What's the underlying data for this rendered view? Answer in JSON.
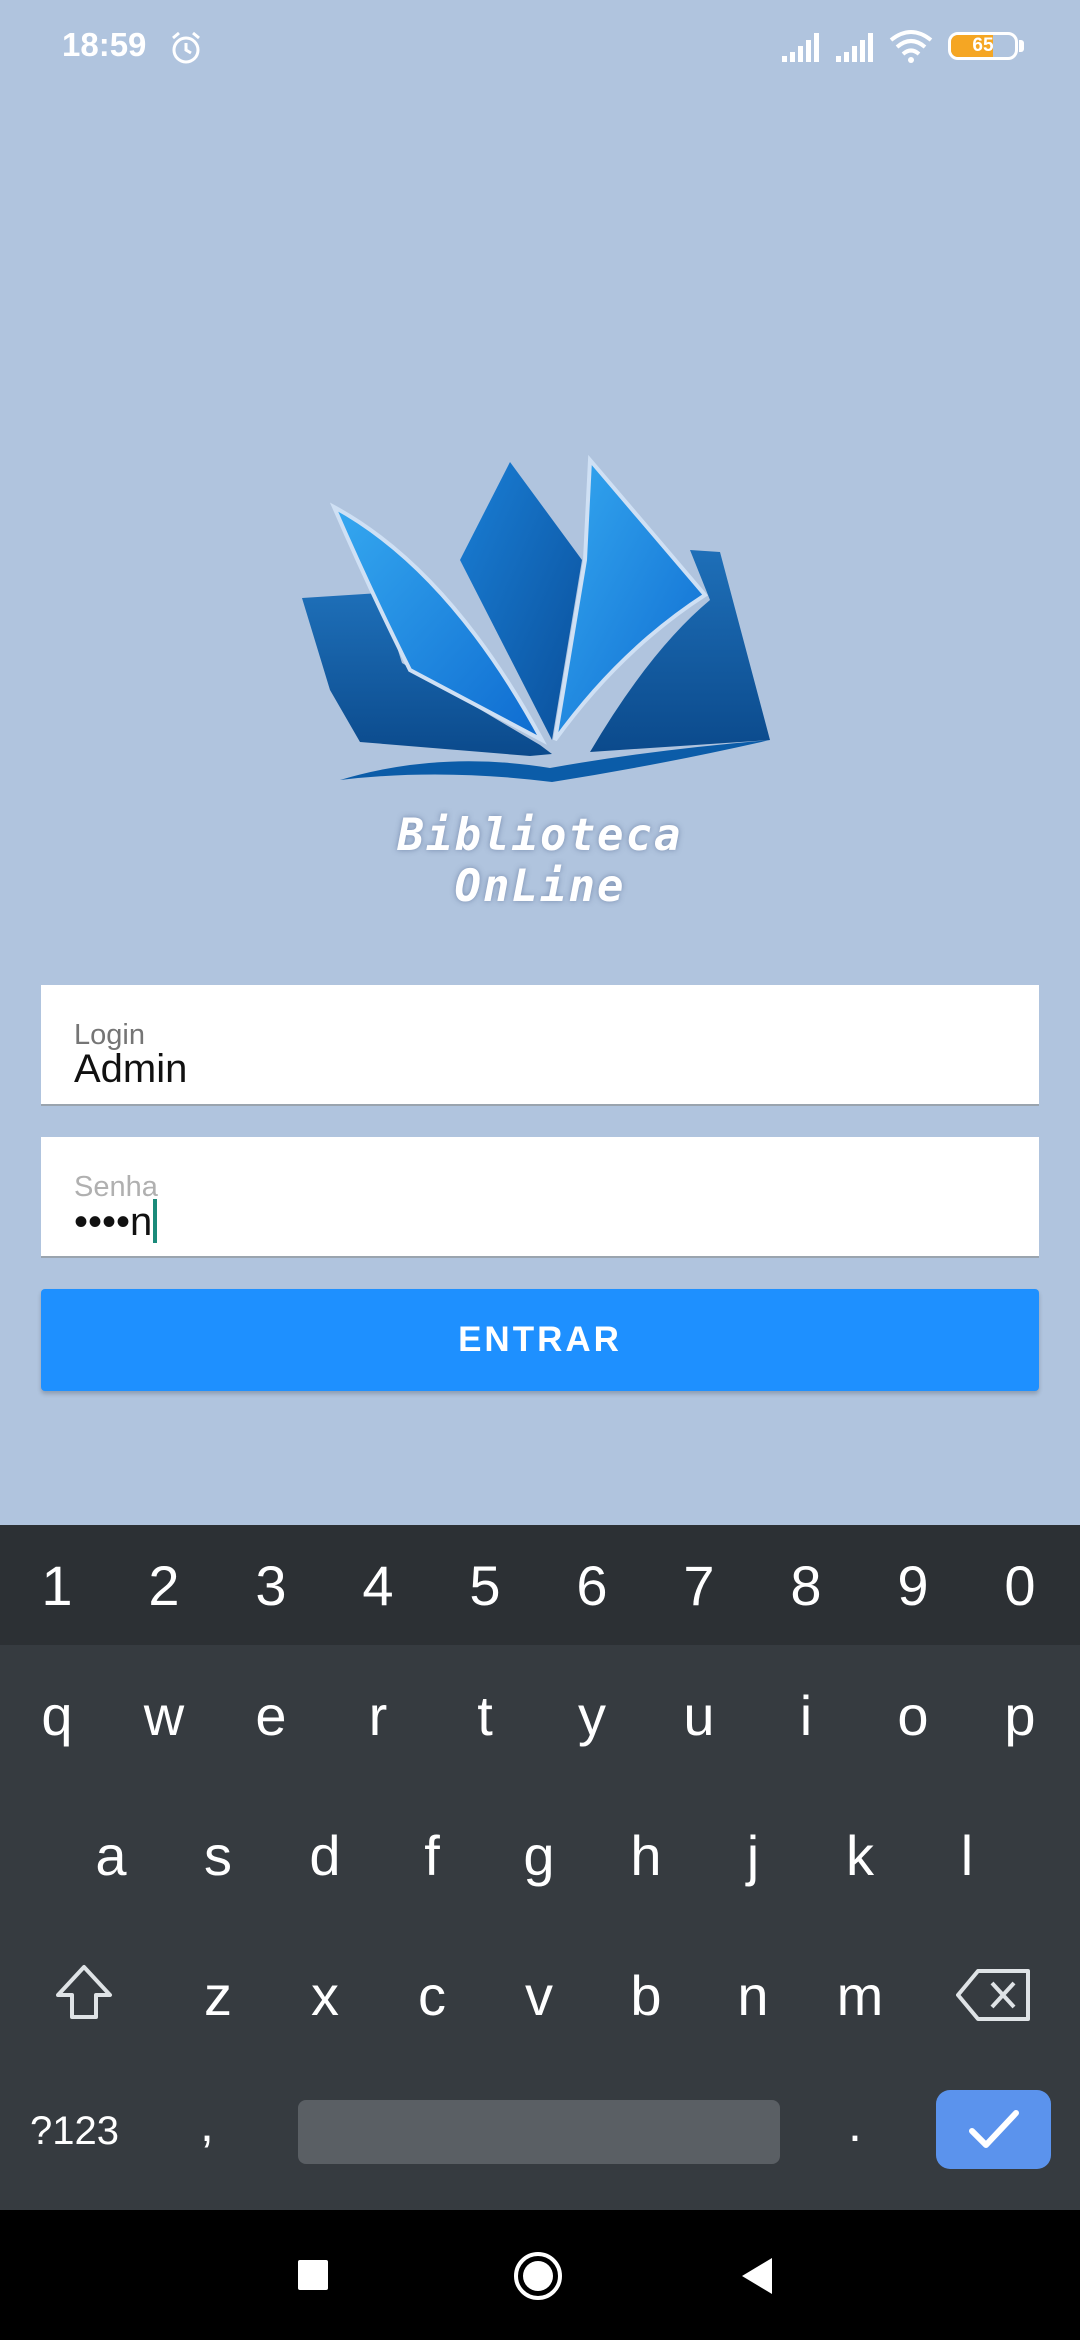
{
  "status_bar": {
    "time": "18:59",
    "battery": "65",
    "battery_level": 0.65
  },
  "logo": {
    "text": "Biblioteca OnLine"
  },
  "form": {
    "login_label": "Login",
    "login_value": "Admin",
    "senha_label": "Senha",
    "senha_value": "••••n",
    "submit_label": "ENTRAR"
  },
  "keyboard": {
    "numbers": [
      "1",
      "2",
      "3",
      "4",
      "5",
      "6",
      "7",
      "8",
      "9",
      "0"
    ],
    "row1": [
      "q",
      "w",
      "e",
      "r",
      "t",
      "y",
      "u",
      "i",
      "o",
      "p"
    ],
    "row2": [
      "a",
      "s",
      "d",
      "f",
      "g",
      "h",
      "j",
      "k",
      "l"
    ],
    "row3": [
      "z",
      "x",
      "c",
      "v",
      "b",
      "n",
      "m"
    ],
    "symbols_label": "?123",
    "comma": ",",
    "period": "."
  },
  "colors": {
    "background": "#b0c4de",
    "button": "#1e90ff",
    "enter_key": "#5b93ed"
  },
  "icons": [
    "alarm-icon",
    "signal-icon",
    "wifi-icon",
    "battery-icon",
    "shift-icon",
    "backspace-icon",
    "check-icon",
    "square-icon",
    "circle-icon",
    "back-triangle-icon"
  ]
}
